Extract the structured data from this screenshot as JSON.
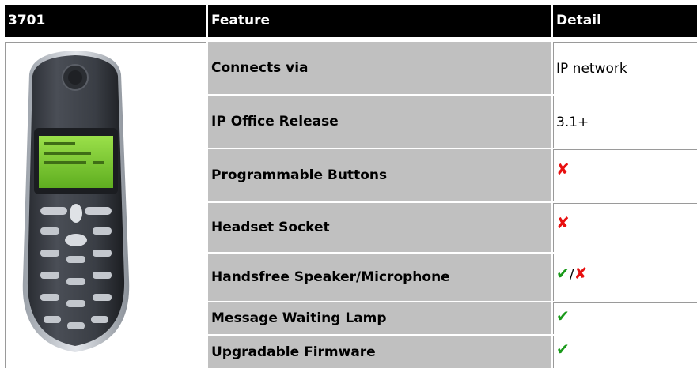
{
  "header": {
    "col1": "3701",
    "col2": "Feature",
    "col3": "Detail"
  },
  "rows": [
    {
      "feature": "Connects via",
      "detail": "IP network"
    },
    {
      "feature": "IP Office Release",
      "detail": "3.1+"
    },
    {
      "feature": "Programmable Buttons",
      "detail_icon": "cross-icon"
    },
    {
      "feature": "Headset Socket",
      "detail_icon": "cross-icon"
    },
    {
      "feature": "Handsfree Speaker/Microphone",
      "detail_icon": "tick-cross-icon"
    },
    {
      "feature": "Message Waiting Lamp",
      "detail_icon": "tick-icon"
    },
    {
      "feature": "Upgradable Firmware",
      "detail_icon": "tick-icon"
    }
  ],
  "icons": {
    "cross": "✘",
    "tick": "✔",
    "separator": "/"
  },
  "colors": {
    "header_bg": "#000000",
    "feature_bg": "#c0c0c0",
    "cross": "#e81010",
    "tick": "#1a9a1a"
  }
}
